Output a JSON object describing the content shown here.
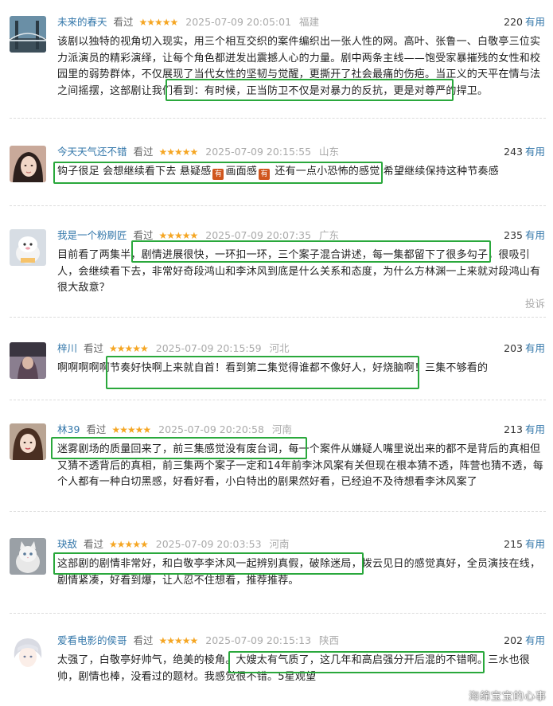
{
  "reviews": [
    {
      "username": "未来的春天",
      "status": "看过",
      "stars": "★★★★★",
      "time": "2025-07-09 20:05:01",
      "location": "福建",
      "useful_count": "220",
      "useful_label": "有用",
      "content": "该剧以独特的视角切入现实，用三个相互交织的案件编织出一张人性的网。高叶、张鲁一、白敬亭三位实力派演员的精彩演绎，让每个角色都迸发出震撼人心的力量。剧中两条主线——饱受家暴摧残的女性和校园里的弱势群体，不仅展现了当代女性的坚韧与觉醒，更撕开了社会最痛的伤疤。当正义的天平在情与法之间摇摆，这部剧让我们看到：有时候，正当防卫不仅是对暴力的反抗，更是对尊严的捍卫。"
    },
    {
      "username": "今天天气还不错",
      "status": "看过",
      "stars": "★★★★★",
      "time": "2025-07-09 20:15:55",
      "location": "山东",
      "useful_count": "243",
      "useful_label": "有用",
      "content_a": "钩子很足 会想继续看下去 悬疑感",
      "tag": "有",
      "content_b": "画面感",
      "content_c": " 还有一点小恐怖的感觉 希望继续保持这种节奏感"
    },
    {
      "username": "我是一个粉刷匠",
      "status": "看过",
      "stars": "★★★★★",
      "time": "2025-07-09 20:07:35",
      "location": "广东",
      "useful_count": "235",
      "useful_label": "有用",
      "content": "目前看了两集半，剧情进展很快，一环扣一环，三个案子混合讲述，每一集都留下了很多勾子，很吸引人，会继续看下去，非常好奇段鸿山和李沐风到底是什么关系和态度，为什么方林渊一上来就对段鸿山有很大敌意？",
      "report": "投诉"
    },
    {
      "username": "梓川",
      "status": "看过",
      "stars": "★★★★★",
      "time": "2025-07-09 20:15:59",
      "location": "河北",
      "useful_count": "203",
      "useful_label": "有用",
      "content": "啊啊啊啊啊节奏好快啊上来就自首！看到第二集觉得谁都不像好人，好烧脑啊！三集不够看的"
    },
    {
      "username": "林39",
      "status": "看过",
      "stars": "★★★★★",
      "time": "2025-07-09 20:20:58",
      "location": "河南",
      "useful_count": "213",
      "useful_label": "有用",
      "content": "迷雾剧场的质量回来了，前三集感觉没有废台词，每一个案件从嫌疑人嘴里说出来的都不是背后的真相但又猜不透背后的真相，前三集两个案子一定和14年前李沐风案有关但现在根本猜不透，阵营也猜不透，每个人都有一种白切黑感，好看好看，小白特出的剧果然好看，已经迫不及待想看李沐风案了"
    },
    {
      "username": "玦敌",
      "status": "看过",
      "stars": "★★★★★",
      "time": "2025-07-09 20:03:53",
      "location": "河南",
      "useful_count": "215",
      "useful_label": "有用",
      "content": "这部剧的剧情非常好，和白敬亭李沐风一起辨别真假，破除迷局，拨云见日的感觉真好，全员演技在线，剧情紧凑，好看到爆，让人忍不住想看，推荐推荐。"
    },
    {
      "username": "爱看电影的侯哥",
      "status": "看过",
      "stars": "★★★★★",
      "time": "2025-07-09 20:15:13",
      "location": "陕西",
      "useful_count": "202",
      "useful_label": "有用",
      "content": "太强了，白敬亭好帅气，绝美的棱角。大嫂太有气质了，这几年和高启强分开后混的不错啊。三水也很帅，剧情也棒，没看过的题材。我感觉很不错。5星观望"
    }
  ],
  "watermark": "海绵宝宝的心事",
  "colors": {
    "highlight_box": "#2aa83c",
    "link": "#3377aa",
    "stars": "#f5a623"
  }
}
